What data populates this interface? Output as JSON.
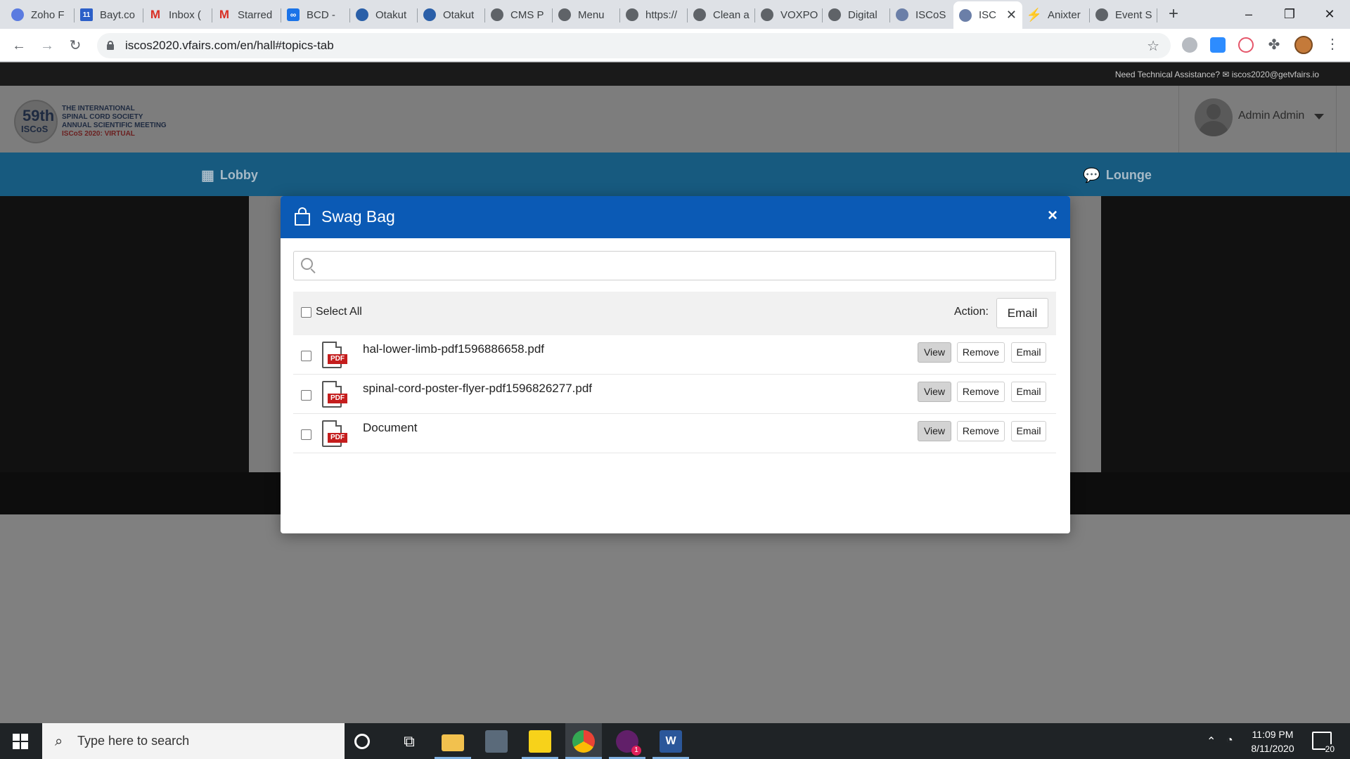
{
  "browser": {
    "tabs": [
      {
        "label": "Zoho F",
        "favicon_color": "#5b7be0"
      },
      {
        "label": "Bayt.co",
        "favicon_color": "#2c5fc8"
      },
      {
        "label": "Inbox (",
        "favicon_color": "#d93025"
      },
      {
        "label": "Starred",
        "favicon_color": "#d93025"
      },
      {
        "label": "BCD -",
        "favicon_color": "#1a73e8"
      },
      {
        "label": "Otakut",
        "favicon_color": "#2a5fa8"
      },
      {
        "label": "Otakut",
        "favicon_color": "#2a5fa8"
      },
      {
        "label": "CMS P",
        "favicon_color": "#5f6368"
      },
      {
        "label": "Menu",
        "favicon_color": "#5f6368"
      },
      {
        "label": "https://",
        "favicon_color": "#5f6368"
      },
      {
        "label": "Clean a",
        "favicon_color": "#5f6368"
      },
      {
        "label": "VOXPO",
        "favicon_color": "#5f6368"
      },
      {
        "label": "Digital",
        "favicon_color": "#5f6368"
      },
      {
        "label": "ISCoS",
        "favicon_color": "#6b7fa8"
      },
      {
        "label": "ISC",
        "favicon_color": "#6b7fa8"
      },
      {
        "label": "Anixter",
        "favicon_color": "#1a73e8"
      },
      {
        "label": "Event S",
        "favicon_color": "#5f6368"
      }
    ],
    "new_tab_label": "+",
    "address": "iscos2020.vfairs.com/en/hall#topics-tab",
    "window_controls": {
      "minimize": "–",
      "restore": "❐",
      "close": "✕"
    }
  },
  "site": {
    "assist_text": "Need Technical Assistance? ✉ iscos2020@getvfairs.io",
    "logo": {
      "number": "59th",
      "sub": "ISCoS",
      "line1": "THE INTERNATIONAL",
      "line2": "SPINAL CORD SOCIETY",
      "line3": "ANNUAL SCIENTIFIC MEETING",
      "line4": "ISCoS 2020: VIRTUAL"
    },
    "user_name": "Admin Admin",
    "nav": {
      "lobby": "Lobby",
      "lounge": "Lounge"
    }
  },
  "modal": {
    "title": "Swag Bag",
    "close": "×",
    "search_placeholder": "",
    "select_all": "Select All",
    "action_label": "Action:",
    "action_button": "Email",
    "files": [
      {
        "name": "hal-lower-limb-pdf1596886658.pdf",
        "type_badge": "PDF"
      },
      {
        "name": "spinal-cord-poster-flyer-pdf1596826277.pdf",
        "type_badge": "PDF"
      },
      {
        "name": "Document",
        "type_badge": "PDF"
      }
    ],
    "row_buttons": {
      "view": "View",
      "remove": "Remove",
      "email": "Email"
    }
  },
  "taskbar": {
    "search_text": "Type here to search",
    "time": "11:09 PM",
    "date": "8/11/2020",
    "notifications": "20",
    "slack_badge": "1"
  }
}
